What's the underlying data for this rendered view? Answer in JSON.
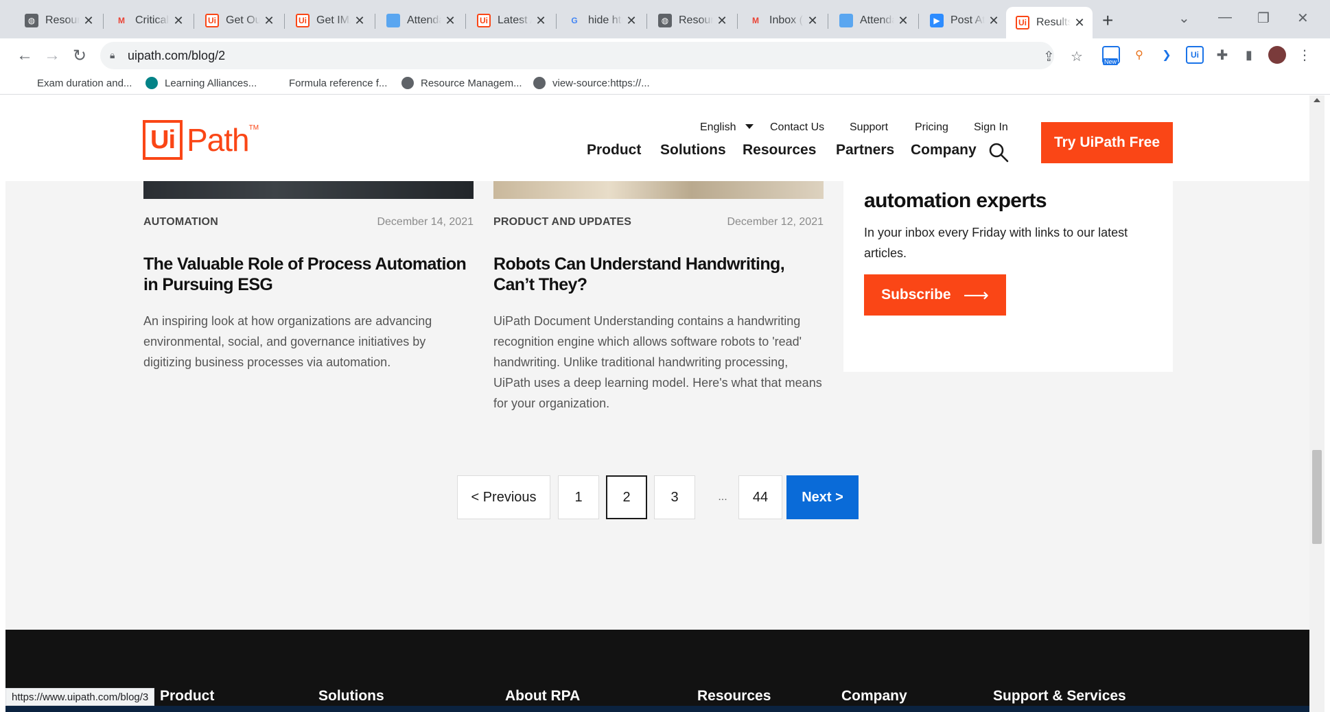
{
  "browser": {
    "tabs": [
      {
        "title": "Resources",
        "icon": "globe-icon"
      },
      {
        "title": "Critical",
        "icon": "gmail-icon"
      },
      {
        "title": "Get Out",
        "icon": "uipath-icon"
      },
      {
        "title": "Get IMA",
        "icon": "uipath-icon"
      },
      {
        "title": "Attendance",
        "icon": "sheet-icon"
      },
      {
        "title": "Latest A",
        "icon": "uipath-icon"
      },
      {
        "title": "hide htm",
        "icon": "google-icon"
      },
      {
        "title": "Resources",
        "icon": "globe-icon"
      },
      {
        "title": "Inbox (S",
        "icon": "gmail-icon"
      },
      {
        "title": "Attendance",
        "icon": "sheet-icon"
      },
      {
        "title": "Post At",
        "icon": "zoom-icon"
      },
      {
        "title": "Results",
        "icon": "uipath-icon"
      }
    ],
    "new_tab": "+",
    "url": "uipath.com/blog/2",
    "extension_badge": "New",
    "bookmarks": [
      {
        "label": "Exam duration and...",
        "icon": "microsoft-icon"
      },
      {
        "label": "Learning Alliances...",
        "icon": "sharepoint-icon"
      },
      {
        "label": "Formula reference f...",
        "icon": "microsoft-icon"
      },
      {
        "label": "Resource Managem...",
        "icon": "globe-icon"
      },
      {
        "label": "view-source:https://...",
        "icon": "globe-icon"
      }
    ],
    "status_url": "https://www.uipath.com/blog/3"
  },
  "site": {
    "logo_ui": "Ui",
    "logo_path": "Path",
    "logo_tm": "TM",
    "util_nav": {
      "language": "English",
      "contact": "Contact Us",
      "support": "Support",
      "pricing": "Pricing",
      "signin": "Sign In"
    },
    "main_nav": [
      "Product",
      "Solutions",
      "Resources",
      "Partners",
      "Company"
    ],
    "cta": "Try UiPath Free",
    "accent_color": "#fa4616",
    "next_color": "#0a6bd8"
  },
  "cards": [
    {
      "category": "AUTOMATION",
      "date": "December 14, 2021",
      "title": "The Valuable Role of Process Automation in Pursuing ESG",
      "excerpt": "An inspiring look at how organizations are advancing environmental, social, and governance initiatives by digitizing business processes via automation."
    },
    {
      "category": "PRODUCT AND UPDATES",
      "date": "December 12, 2021",
      "title": "Robots Can Understand Handwriting, Can’t They?",
      "excerpt": "UiPath Document Understanding contains a handwriting recognition engine which allows software robots to 'read' handwriting. Unlike traditional handwriting processing, UiPath uses a deep learning model. Here's what that means for your organization."
    }
  ],
  "newsletter": {
    "heading": "automation experts",
    "text": "In your inbox every Friday with links to our latest articles.",
    "button": "Subscribe",
    "button_arrow": "⟶"
  },
  "pagination": {
    "previous": "<  Previous",
    "pages": [
      "1",
      "2",
      "3",
      "...",
      "44"
    ],
    "current": "2",
    "next": "Next  >"
  },
  "footer": {
    "headings": [
      "Product",
      "Solutions",
      "About RPA",
      "Resources",
      "Company",
      "Support & Services"
    ]
  }
}
